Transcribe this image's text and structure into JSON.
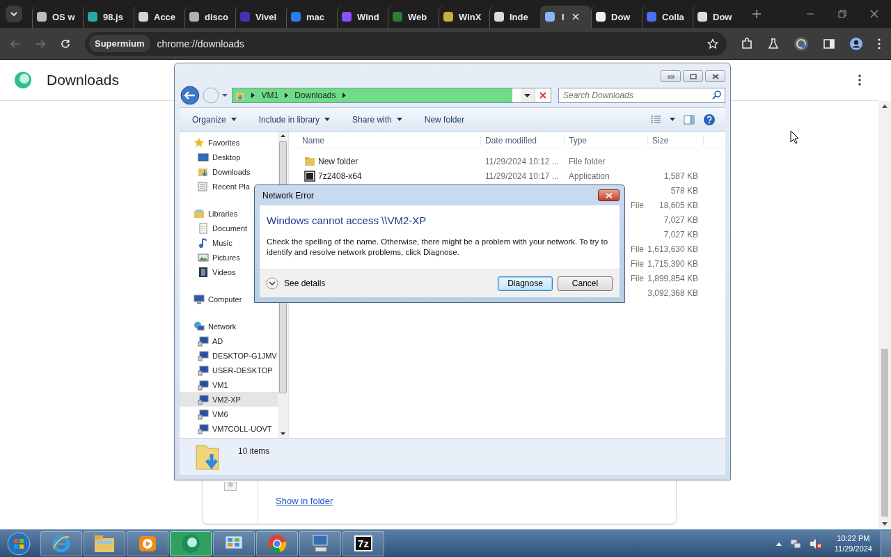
{
  "browser": {
    "tabs": [
      {
        "title": "OS w",
        "color": "#bdbdbd",
        "selected": false
      },
      {
        "title": "98.js",
        "color": "#2fa4a4",
        "selected": false
      },
      {
        "title": "Acce",
        "color": "#d6d6d6",
        "selected": false
      },
      {
        "title": "disco",
        "color": "#b0b0b0",
        "selected": false
      },
      {
        "title": "Vivel",
        "color": "#4a2fb5",
        "selected": false
      },
      {
        "title": "mac",
        "color": "#2b7de9",
        "selected": false
      },
      {
        "title": "Wind",
        "color": "#8a4fff",
        "selected": false
      },
      {
        "title": "Web",
        "color": "#2e7d32",
        "selected": false
      },
      {
        "title": "WinX",
        "color": "#c9b037",
        "selected": false
      },
      {
        "title": "Inde",
        "color": "#d9d9d9",
        "selected": false
      },
      {
        "title": "I",
        "color": "#8ab4f8",
        "selected": true
      },
      {
        "title": "Dow",
        "color": "#eeeeee",
        "selected": false
      },
      {
        "title": "Colla",
        "color": "#4c6ef5",
        "selected": false
      },
      {
        "title": "Dow",
        "color": "#dddddd",
        "selected": false
      }
    ],
    "omnibox": {
      "chip": "Supermium",
      "url": "chrome://downloads"
    }
  },
  "page": {
    "title": "Downloads",
    "card": {
      "link": "Show in folder"
    }
  },
  "explorer": {
    "breadcrumb": [
      "VM1",
      "Downloads"
    ],
    "address_progress": {
      "level": 0.88
    },
    "search": {
      "placeholder": "Search Downloads"
    },
    "commands": [
      {
        "label": "Organize",
        "menu": true
      },
      {
        "label": "Include in library",
        "menu": true
      },
      {
        "label": "Share with",
        "menu": true
      },
      {
        "label": "New folder",
        "menu": false
      }
    ],
    "nav": [
      {
        "label": "Favorites",
        "kind": "star",
        "children": [
          {
            "label": "Desktop",
            "kind": "desktop",
            "selected": false
          },
          {
            "label": "Downloads",
            "kind": "downloads",
            "selected": false
          },
          {
            "label": "Recent Pla",
            "kind": "recent",
            "selected": false
          }
        ]
      },
      {
        "label": "Libraries",
        "kind": "library",
        "children": [
          {
            "label": "Document",
            "kind": "document",
            "selected": false
          },
          {
            "label": "Music",
            "kind": "music",
            "selected": false
          },
          {
            "label": "Pictures",
            "kind": "pictures",
            "selected": false
          },
          {
            "label": "Videos",
            "kind": "videos",
            "selected": false
          }
        ]
      },
      {
        "label": "Computer",
        "kind": "computer"
      },
      {
        "label": "Network",
        "kind": "network",
        "children": [
          {
            "label": "AD",
            "kind": "pc",
            "selected": false
          },
          {
            "label": "DESKTOP-G1JMV",
            "kind": "pc",
            "selected": false
          },
          {
            "label": "USER-DESKTOP",
            "kind": "pc",
            "selected": false
          },
          {
            "label": "VM1",
            "kind": "pc",
            "selected": false
          },
          {
            "label": "VM2-XP",
            "kind": "pc",
            "selected": true
          },
          {
            "label": "VM6",
            "kind": "pc",
            "selected": false
          },
          {
            "label": "VM7COLL-UOVT",
            "kind": "pc",
            "selected": false
          }
        ]
      }
    ],
    "columns": [
      "Name",
      "Date modified",
      "Type",
      "Size"
    ],
    "rows": [
      {
        "kind": "folder",
        "name": "New folder",
        "date": "11/29/2024 10:12 ...",
        "type": "File folder"
      },
      {
        "kind": "app",
        "name": "7z2408-x64",
        "date": "11/29/2024 10:17 ...",
        "type": "Application",
        "size": "1,587 KB"
      },
      {
        "size": "578 KB"
      },
      {
        "type": "File",
        "size": "18,605 KB"
      },
      {
        "size": "7,027 KB"
      },
      {
        "size": "7,027 KB"
      },
      {
        "type": "File",
        "size": "1,613,630 KB"
      },
      {
        "type": "File",
        "size": "1,715,390 KB"
      },
      {
        "type": "File",
        "size": "1,899,854 KB"
      },
      {
        "size": "3,092,368 KB"
      }
    ],
    "status": "10 items"
  },
  "dialog": {
    "title": "Network Error",
    "heading": "Windows cannot access \\\\VM2-XP",
    "message": "Check the spelling of the name. Otherwise, there might be a problem with your network. To try to identify and resolve network problems, click Diagnose.",
    "details": "See details",
    "buttons": [
      {
        "label": "Diagnose",
        "default": true
      },
      {
        "label": "Cancel",
        "default": false
      }
    ]
  },
  "taskbar": {
    "items": [
      {
        "kind": "ie",
        "active": false
      },
      {
        "kind": "explorer",
        "active": false
      },
      {
        "kind": "media",
        "active": false
      },
      {
        "kind": "supermium",
        "active": true
      },
      {
        "kind": "control",
        "active": false
      },
      {
        "kind": "chrome",
        "active": false
      },
      {
        "kind": "network",
        "active": false
      },
      {
        "kind": "sevenzip",
        "label": "7z",
        "active": false
      }
    ],
    "time": "10:22 PM",
    "date": "11/29/2024"
  }
}
